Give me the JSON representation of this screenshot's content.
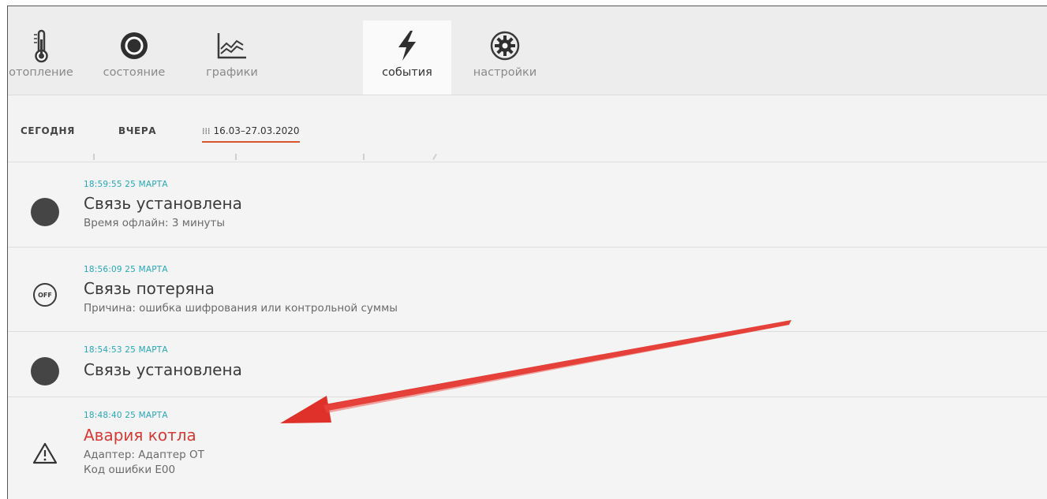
{
  "tabs": [
    {
      "label": "отопление",
      "icon": "thermometer-icon",
      "active": false
    },
    {
      "label": "состояние",
      "icon": "status-circle-icon",
      "active": false
    },
    {
      "label": "графики",
      "icon": "chart-icon",
      "active": false
    },
    {
      "label": "события",
      "icon": "lightning-icon",
      "active": true
    },
    {
      "label": "настройки",
      "icon": "gear-icon",
      "active": false
    }
  ],
  "filters": {
    "today": "СЕГОДНЯ",
    "yesterday": "ВЧЕРА",
    "range": "16.03–27.03.2020"
  },
  "events": [
    {
      "time": "18:59:55 25 МАРТА",
      "title": "Связь установлена",
      "details": [
        "Время офлайн: 3 минуты"
      ],
      "icon": "online-dot-icon"
    },
    {
      "time": "18:56:09 25 МАРТА",
      "title": "Связь потеряна",
      "details": [
        "Причина: ошибка шифрования или контрольной суммы"
      ],
      "icon": "off-icon",
      "icon_text": "OFF"
    },
    {
      "time": "18:54:53 25 МАРТА",
      "title": "Связь установлена",
      "details": [],
      "icon": "online-dot-icon"
    },
    {
      "time": "18:48:40 25 МАРТА",
      "title": "Авария котла",
      "details": [
        "Адаптер: Адаптер ОТ",
        "Код ошибки E00"
      ],
      "icon": "warning-triangle-icon",
      "alarm": true
    }
  ],
  "colors": {
    "accent_underline": "#d9532c",
    "time_text": "#25a8b8",
    "alarm_text": "#d63c36",
    "arrow": "#e0302a"
  }
}
